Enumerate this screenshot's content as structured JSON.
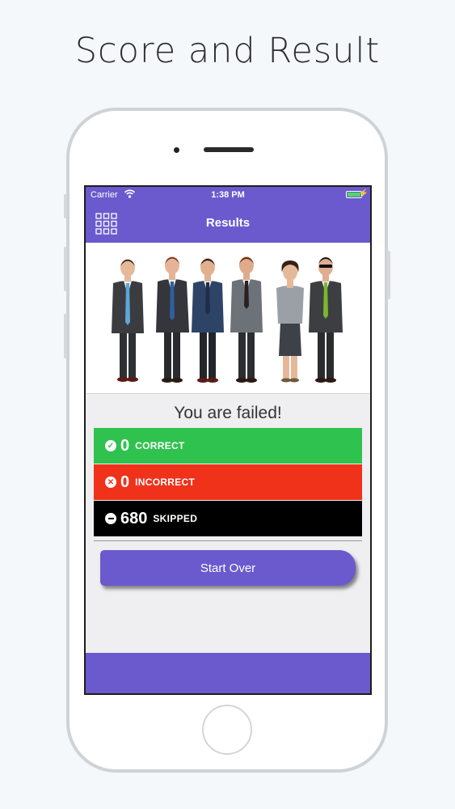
{
  "headline": "Score and Result",
  "status_bar": {
    "carrier": "Carrier",
    "time": "1:38 PM"
  },
  "nav": {
    "title": "Results",
    "menu_icon": "grid-menu-icon"
  },
  "result_message": "You are failed!",
  "results": [
    {
      "count": "0",
      "label": "CORRECT",
      "icon": "check-circle-icon",
      "color": "#2fc24f"
    },
    {
      "count": "0",
      "label": "INCORRECT",
      "icon": "x-circle-icon",
      "color": "#f0321b"
    },
    {
      "count": "680",
      "label": "SKIPPED",
      "icon": "minus-circle-icon",
      "color": "#000000"
    }
  ],
  "start_over_label": "Start Over",
  "colors": {
    "accent": "#6a5acd",
    "correct": "#2fc24f",
    "incorrect": "#f0321b",
    "skipped": "#000000"
  }
}
